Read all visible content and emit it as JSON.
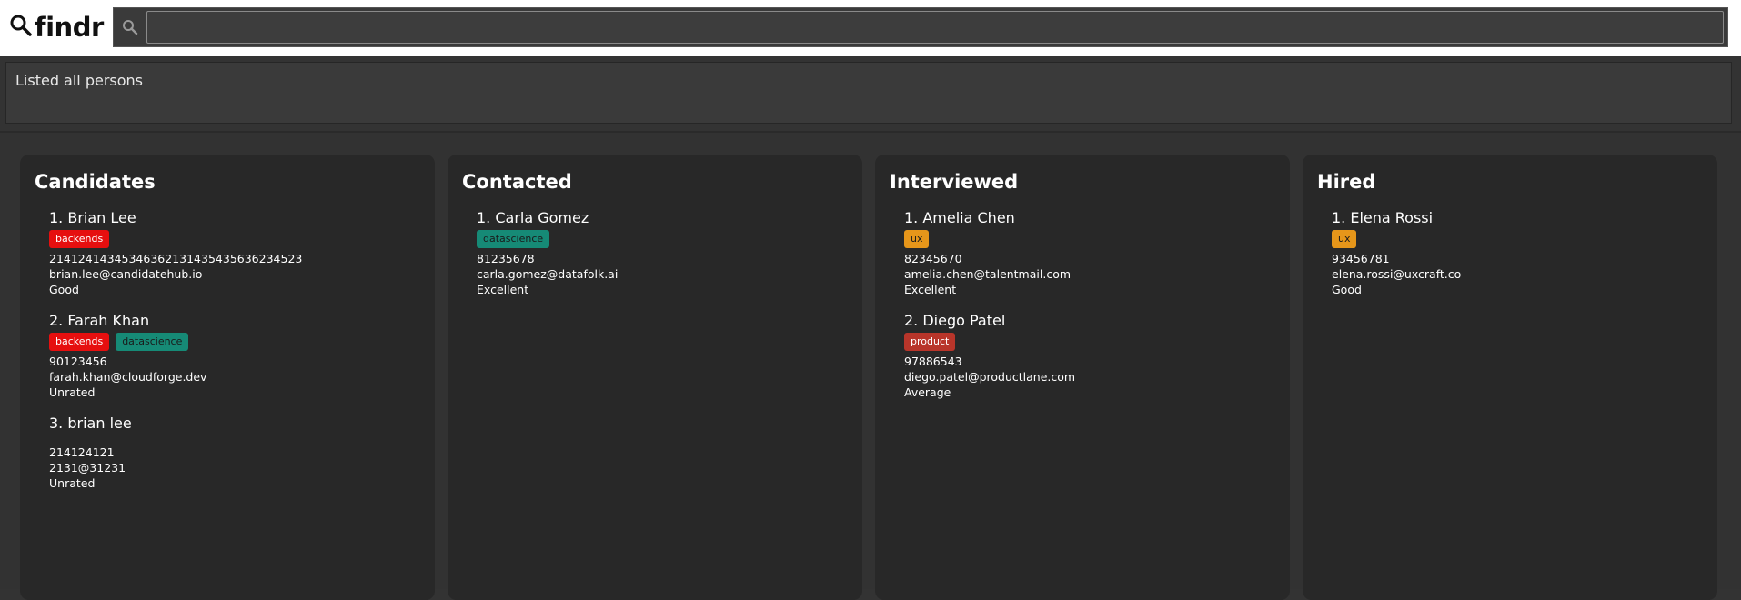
{
  "app": {
    "logo_text": "findr",
    "search_value": ""
  },
  "result": {
    "message": "Listed all persons"
  },
  "columns": [
    {
      "title": "Candidates",
      "persons": [
        {
          "name": "1. Brian Lee",
          "tags": [
            {
              "label": "backends",
              "color": "#e60f0f",
              "text_color": "#ffffff"
            }
          ],
          "phone": "2141241434534636213143543563623452 3",
          "email": "brian.lee@candidatehub.io",
          "rating": "Good"
        }
      ]
    }
  ]
}
